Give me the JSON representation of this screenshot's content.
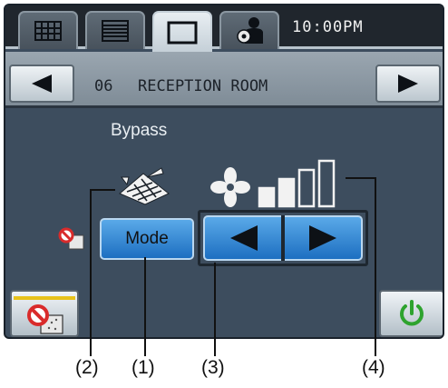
{
  "header": {
    "tabs": [
      {
        "name": "grid-view-tab",
        "icon": "grid-icon",
        "active": false
      },
      {
        "name": "list-view-tab",
        "icon": "list-icon",
        "active": false
      },
      {
        "name": "single-view-tab",
        "icon": "square-icon",
        "active": true
      },
      {
        "name": "maintenance-tab",
        "icon": "maintenance-user-icon",
        "active": false
      }
    ],
    "clock": "10:00PM"
  },
  "room": {
    "number": "06",
    "name": "RECEPTION ROOM"
  },
  "status": {
    "ventilation_mode": "Bypass",
    "fan_speed_level": 2,
    "fan_speed_max": 4
  },
  "controls": {
    "mode_label": "Mode"
  },
  "callouts": {
    "c1": "(1)",
    "c2": "(2)",
    "c3": "(3)",
    "c4": "(4)"
  },
  "colors": {
    "screen_bg": "#3d4d5e",
    "button_blue": "#1d6fc1",
    "power_green": "#2ea32e",
    "prohibit_red": "#d92b2b"
  }
}
